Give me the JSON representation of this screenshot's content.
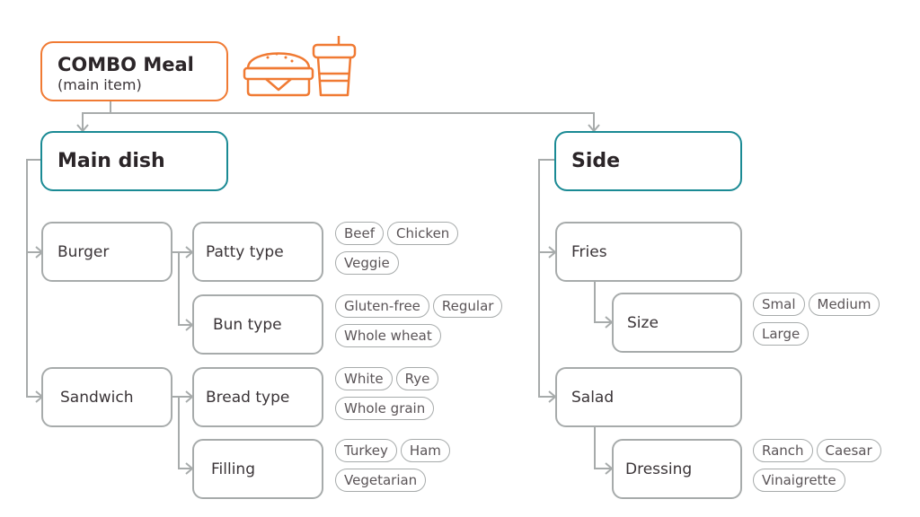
{
  "root": {
    "title": "COMBO Meal",
    "subtitle": "(main item)",
    "icons": [
      "burger-icon",
      "drink-cup-icon"
    ]
  },
  "colors": {
    "root_border": "#f07a33",
    "category_border": "#1a8a94",
    "node_border": "#a7abab",
    "connector": "#a7abab",
    "text": "#3a3437"
  },
  "main_dish": {
    "label": "Main dish",
    "items": [
      {
        "label": "Burger",
        "options": [
          {
            "label": "Patty type",
            "choices": [
              "Beef",
              "Chicken",
              "Veggie"
            ]
          },
          {
            "label": "Bun type",
            "choices": [
              "Gluten-free",
              "Regular",
              "Whole wheat"
            ]
          }
        ]
      },
      {
        "label": "Sandwich",
        "options": [
          {
            "label": "Bread type",
            "choices": [
              "White",
              "Rye",
              "Whole grain"
            ]
          },
          {
            "label": "Filling",
            "choices": [
              "Turkey",
              "Ham",
              "Vegetarian"
            ]
          }
        ]
      }
    ]
  },
  "side": {
    "label": "Side",
    "items": [
      {
        "label": "Fries",
        "options": [
          {
            "label": "Size",
            "choices": [
              "Smal",
              "Medium",
              "Large"
            ]
          }
        ]
      },
      {
        "label": "Salad",
        "options": [
          {
            "label": "Dressing",
            "choices": [
              "Ranch",
              "Caesar",
              "Vinaigrette"
            ]
          }
        ]
      }
    ]
  }
}
